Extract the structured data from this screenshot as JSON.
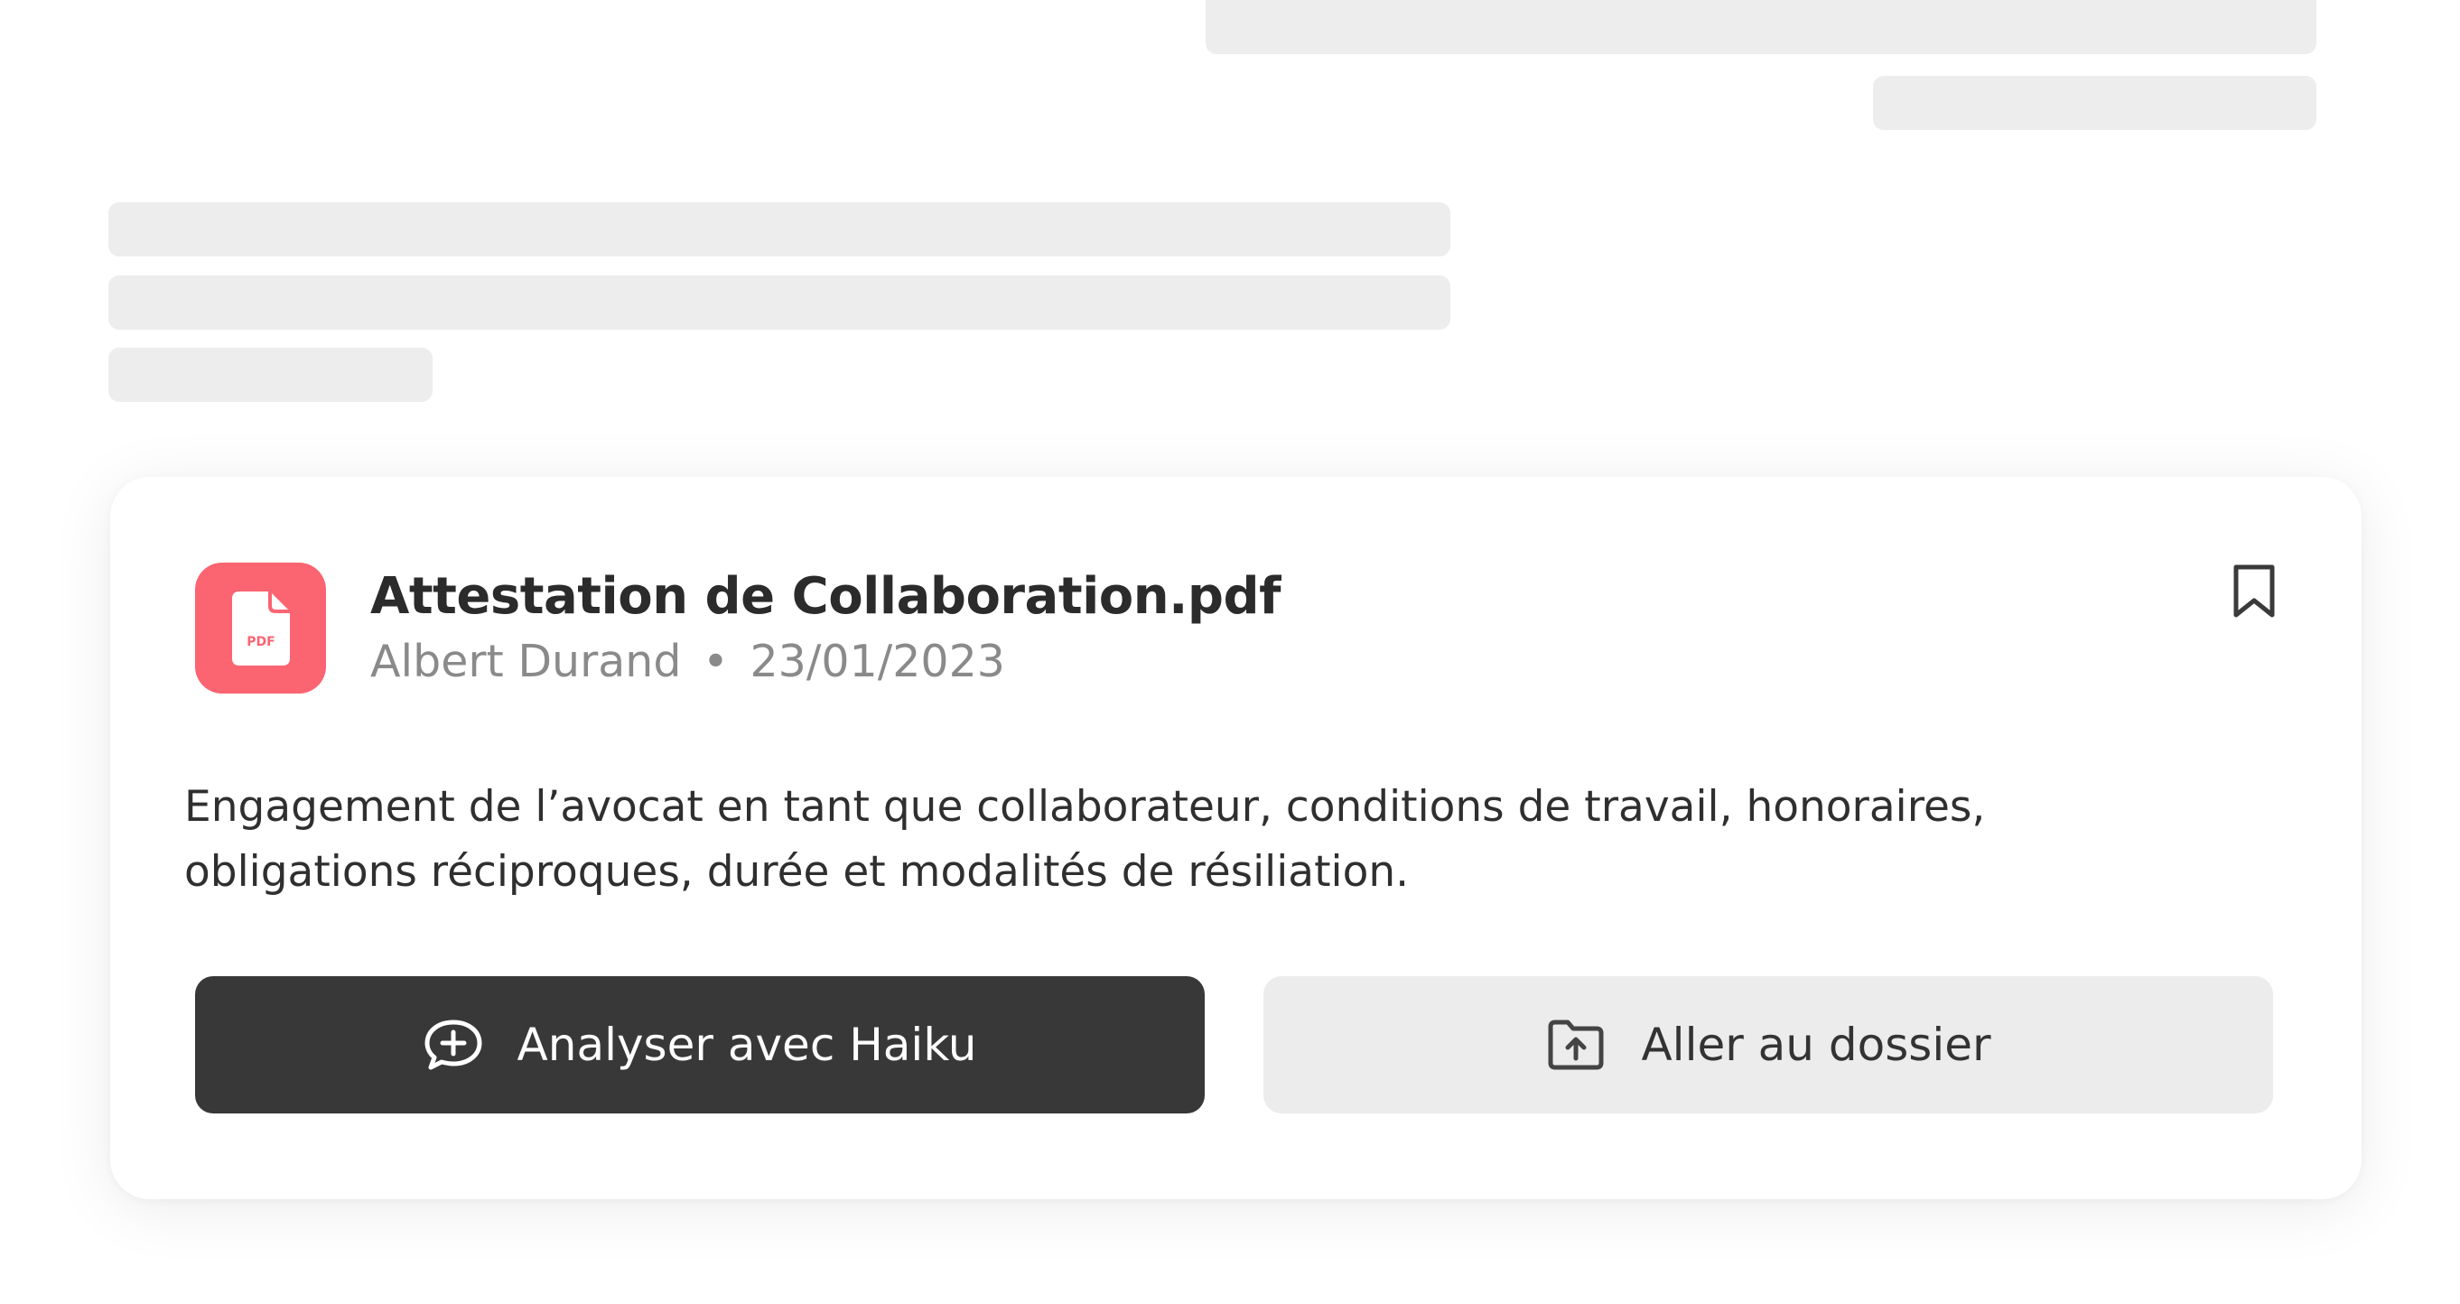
{
  "document": {
    "title": "Attestation de Collaboration.pdf",
    "file_type_label": "PDF",
    "author": "Albert Durand",
    "separator": "•",
    "date": "23/01/2023",
    "description_lines": [
      "Engagement de l’avocat en tant que collaborateur, conditions de travail, honoraires,",
      "obligations réciproques, durée et modalités de résiliation."
    ]
  },
  "actions": {
    "analyze_label": "Analyser avec Haiku",
    "folder_label": "Aller au dossier"
  },
  "icons": {
    "file": "pdf-file-icon",
    "bookmark": "bookmark-icon",
    "analyze": "chat-plus-icon",
    "folder": "folder-upload-icon"
  },
  "colors": {
    "pdf_accent": "#fb6471",
    "primary_button": "#383838",
    "secondary_button": "#ececec",
    "skeleton": "#ededed"
  }
}
